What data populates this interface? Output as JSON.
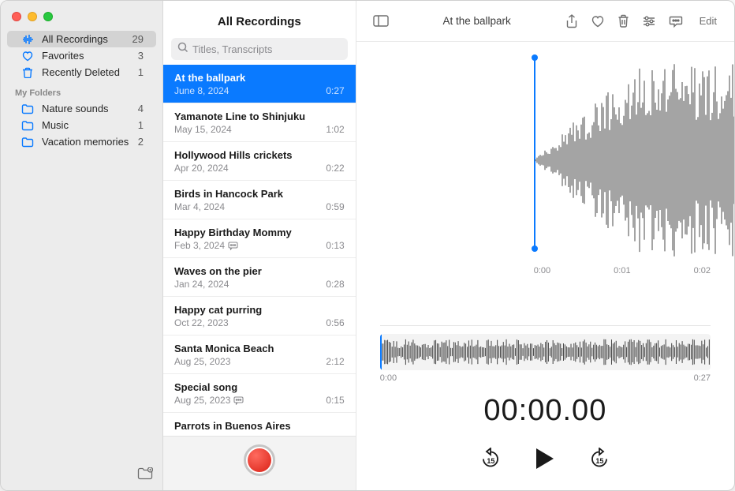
{
  "sidebar": {
    "smart": [
      {
        "icon": "waveform",
        "label": "All Recordings",
        "count": "29",
        "sel": true
      },
      {
        "icon": "heart",
        "label": "Favorites",
        "count": "3"
      },
      {
        "icon": "trash",
        "label": "Recently Deleted",
        "count": "1"
      }
    ],
    "headerLabel": "My Folders",
    "folders": [
      {
        "label": "Nature sounds",
        "count": "4"
      },
      {
        "label": "Music",
        "count": "1"
      },
      {
        "label": "Vacation memories",
        "count": "2"
      }
    ]
  },
  "middle": {
    "title": "All Recordings",
    "searchPlaceholder": "Titles, Transcripts",
    "recordings": [
      {
        "title": "At the ballpark",
        "date": "June 8, 2024",
        "dur": "0:27",
        "sel": true
      },
      {
        "title": "Yamanote Line to Shinjuku",
        "date": "May 15, 2024",
        "dur": "1:02"
      },
      {
        "title": "Hollywood Hills crickets",
        "date": "Apr 20, 2024",
        "dur": "0:22"
      },
      {
        "title": "Birds in Hancock Park",
        "date": "Mar 4, 2024",
        "dur": "0:59"
      },
      {
        "title": "Happy Birthday Mommy",
        "date": "Feb 3, 2024",
        "dur": "0:13",
        "tx": true
      },
      {
        "title": "Waves on the pier",
        "date": "Jan 24, 2024",
        "dur": "0:28"
      },
      {
        "title": "Happy cat purring",
        "date": "Oct 22, 2023",
        "dur": "0:56"
      },
      {
        "title": "Santa Monica Beach",
        "date": "Aug 25, 2023",
        "dur": "2:12"
      },
      {
        "title": "Special song",
        "date": "Aug 25, 2023",
        "dur": "0:15",
        "tx": true
      },
      {
        "title": "Parrots in Buenos Aires",
        "date": "",
        "dur": ""
      }
    ]
  },
  "toolbar": {
    "title": "At the ballpark",
    "editLabel": "Edit"
  },
  "detail": {
    "axis": [
      "0:00",
      "0:01",
      "0:02"
    ],
    "smallStart": "0:00",
    "smallEnd": "0:27",
    "clock": "00:00.00",
    "skip": "15"
  }
}
